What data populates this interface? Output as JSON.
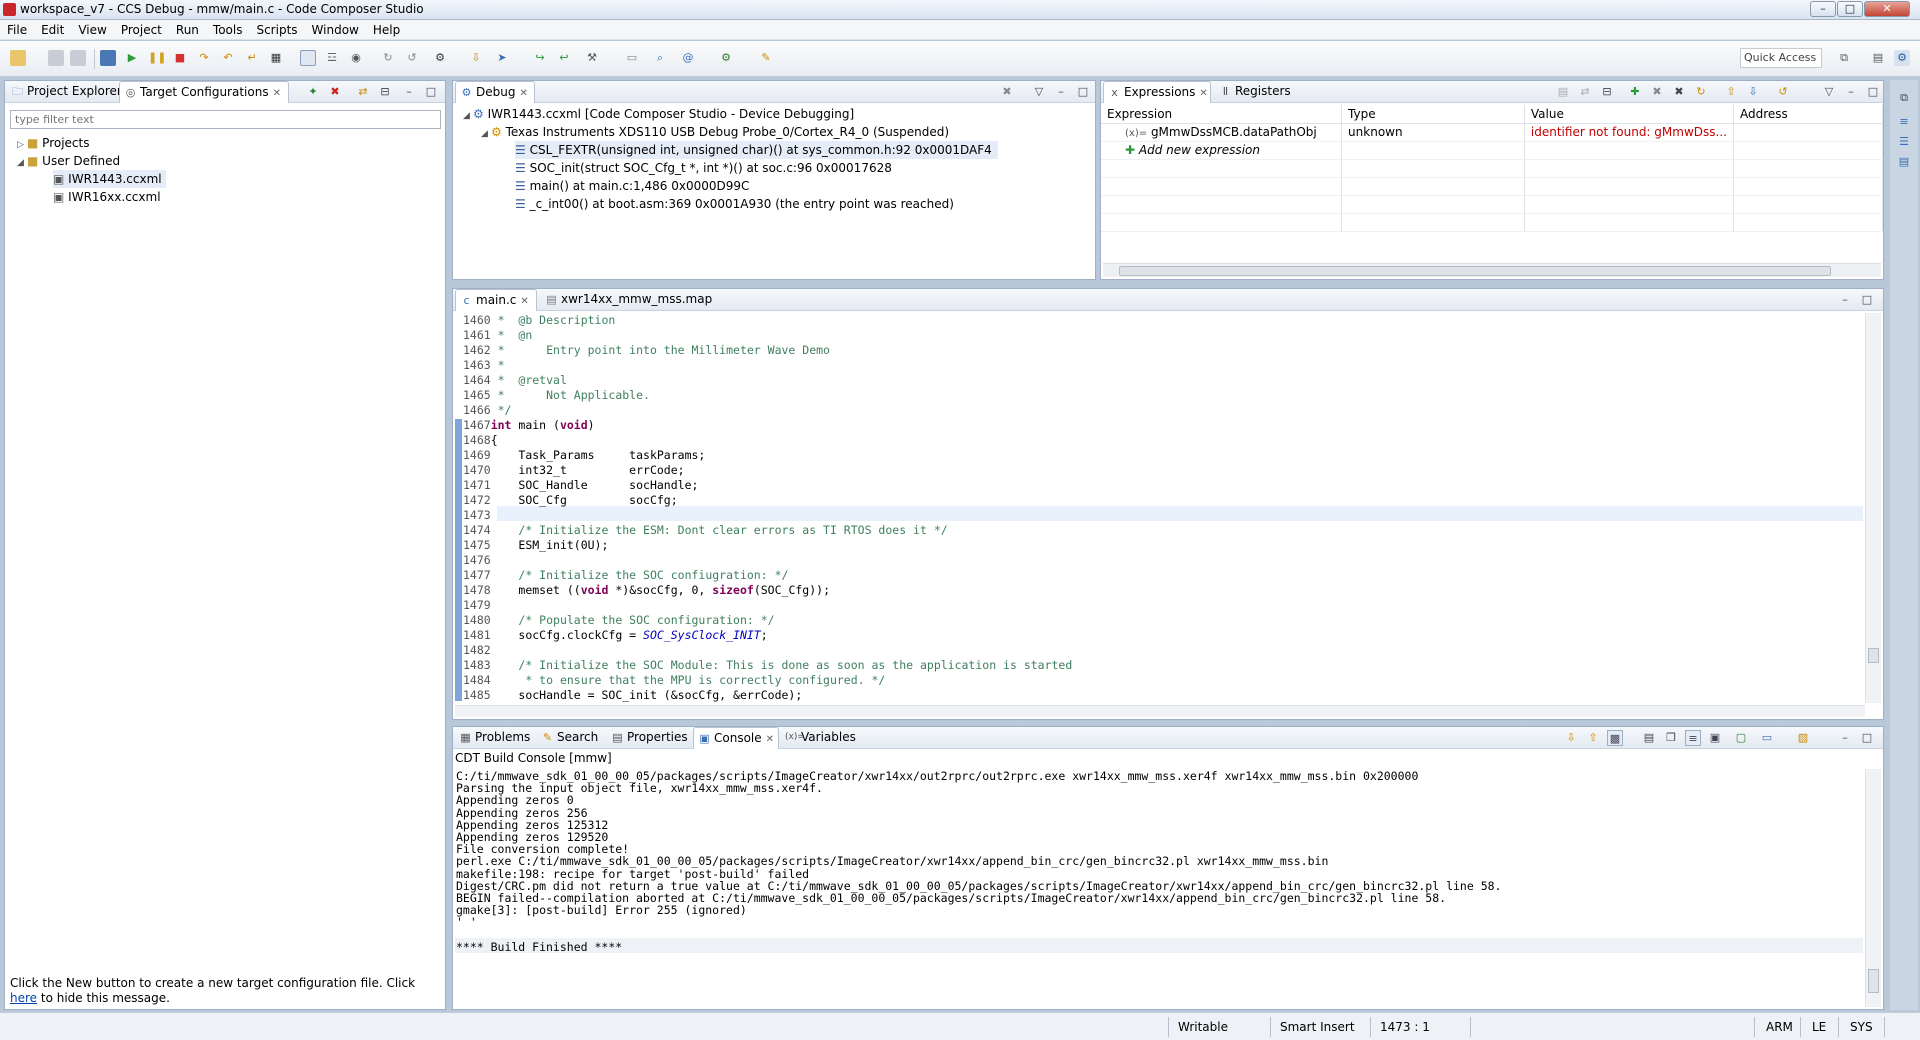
{
  "window": {
    "title": "workspace_v7 - CCS Debug - mmw/main.c - Code Composer Studio"
  },
  "menu": [
    "File",
    "Edit",
    "View",
    "Project",
    "Run",
    "Tools",
    "Scripts",
    "Window",
    "Help"
  ],
  "toolbar": {
    "quick_access": "Quick Access"
  },
  "left": {
    "tabs": [
      {
        "label": "Project Explorer",
        "icon": "folder-icon"
      },
      {
        "label": "Target Configurations",
        "icon": "target-icon"
      }
    ],
    "filter_placeholder": "type filter text",
    "tree": [
      {
        "label": "Projects",
        "level": 0,
        "expanded": false,
        "icon": "folder-icon"
      },
      {
        "label": "User Defined",
        "level": 0,
        "expanded": true,
        "icon": "folder-icon"
      },
      {
        "label": "IWR1443.ccxml",
        "level": 1,
        "icon": "ccxml-file-icon",
        "selected": true
      },
      {
        "label": "IWR16xx.ccxml",
        "level": 1,
        "icon": "ccxml-file-icon"
      }
    ],
    "hint_before": "Click the New button to create a new target configuration file. Click ",
    "hint_link": "here",
    "hint_after": " to hide this message."
  },
  "debug": {
    "tab": "Debug",
    "rows": [
      {
        "text": "IWR1443.ccxml [Code Composer Studio - Device Debugging]",
        "level": 0
      },
      {
        "text": "Texas Instruments XDS110 USB Debug Probe_0/Cortex_R4_0 (Suspended)",
        "level": 1
      },
      {
        "text": "CSL_FEXTR(unsigned int, unsigned char)() at sys_common.h:92 0x0001DAF4",
        "level": 2,
        "selected": true
      },
      {
        "text": "SOC_init(struct SOC_Cfg_t *, int *)() at soc.c:96 0x00017628",
        "level": 2
      },
      {
        "text": "main() at main.c:1,486 0x0000D99C",
        "level": 2
      },
      {
        "text": "_c_int00() at boot.asm:369 0x0001A930  (the entry point was reached)",
        "level": 2
      }
    ]
  },
  "expressions": {
    "tabs": [
      "Expressions",
      "Registers"
    ],
    "columns": [
      "Expression",
      "Type",
      "Value",
      "Address"
    ],
    "rows": [
      {
        "expression": "gMmwDssMCB.dataPathObj",
        "type": "unknown",
        "value": "identifier not found: gMmwDss...",
        "address": ""
      }
    ],
    "add_label": "Add new expression",
    "error_color": "#c00000"
  },
  "editor": {
    "tabs": [
      "main.c",
      "xwr14xx_mmw_mss.map"
    ],
    "lines": [
      {
        "n": "1460",
        "t": " *  @b Description"
      },
      {
        "n": "1461",
        "t": " *  @n"
      },
      {
        "n": "1462",
        "t": " *      Entry point into the Millimeter Wave Demo"
      },
      {
        "n": "1463",
        "t": " *"
      },
      {
        "n": "1464",
        "t": " *  @retval"
      },
      {
        "n": "1465",
        "t": " *      Not Applicable."
      },
      {
        "n": "1466",
        "t": " */"
      },
      {
        "n": "1467",
        "t": "int main (void)"
      },
      {
        "n": "1468",
        "t": "{"
      },
      {
        "n": "1469",
        "t": "    Task_Params     taskParams;"
      },
      {
        "n": "1470",
        "t": "    int32_t         errCode;"
      },
      {
        "n": "1471",
        "t": "    SOC_Handle      socHandle;"
      },
      {
        "n": "1472",
        "t": "    SOC_Cfg         socCfg;"
      },
      {
        "n": "1473",
        "t": ""
      },
      {
        "n": "1474",
        "t": "    /* Initialize the ESM: Dont clear errors as TI RTOS does it */"
      },
      {
        "n": "1475",
        "t": "    ESM_init(0U);"
      },
      {
        "n": "1476",
        "t": ""
      },
      {
        "n": "1477",
        "t": "    /* Initialize the SOC confiugration: */"
      },
      {
        "n": "1478",
        "t": "    memset ((void *)&socCfg, 0, sizeof(SOC_Cfg));"
      },
      {
        "n": "1479",
        "t": ""
      },
      {
        "n": "1480",
        "t": "    /* Populate the SOC configuration: */"
      },
      {
        "n": "1481",
        "t": "    socCfg.clockCfg = SOC_SysClock_INIT;"
      },
      {
        "n": "1482",
        "t": ""
      },
      {
        "n": "1483",
        "t": "    /* Initialize the SOC Module: This is done as soon as the application is started"
      },
      {
        "n": "1484",
        "t": "     * to ensure that the MPU is correctly configured. */"
      },
      {
        "n": "1485",
        "t": "    socHandle = SOC_init (&socCfg, &errCode);"
      }
    ]
  },
  "bottom": {
    "tabs": [
      "Problems",
      "Search",
      "Properties",
      "Console",
      "Variables"
    ],
    "console_title": "CDT Build Console [mmw]",
    "console_lines": [
      "C:/ti/mmwave_sdk_01_00_00_05/packages/scripts/ImageCreator/xwr14xx/out2rprc/out2rprc.exe xwr14xx_mmw_mss.xer4f xwr14xx_mmw_mss.bin 0x200000",
      "Parsing the input object file, xwr14xx_mmw_mss.xer4f.",
      "Appending zeros 0",
      "Appending zeros 256",
      "Appending zeros 125312",
      "Appending zeros 129520",
      "File conversion complete!",
      "perl.exe C:/ti/mmwave_sdk_01_00_00_05/packages/scripts/ImageCreator/xwr14xx/append_bin_crc/gen_bincrc32.pl xwr14xx_mmw_mss.bin",
      "makefile:198: recipe for target 'post-build' failed",
      "Digest/CRC.pm did not return a true value at C:/ti/mmwave_sdk_01_00_00_05/packages/scripts/ImageCreator/xwr14xx/append_bin_crc/gen_bincrc32.pl line 58.",
      "BEGIN failed--compilation aborted at C:/ti/mmwave_sdk_01_00_00_05/packages/scripts/ImageCreator/xwr14xx/append_bin_crc/gen_bincrc32.pl line 58.",
      "gmake[3]: [post-build] Error 255 (ignored)",
      "' '",
      "",
      "**** Build Finished ****"
    ]
  },
  "status": {
    "writable": "Writable",
    "insert": "Smart Insert",
    "position": "1473 : 1",
    "arch": "ARM",
    "endian": "LE",
    "mode": "SYS"
  }
}
